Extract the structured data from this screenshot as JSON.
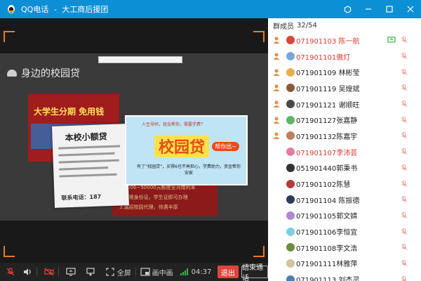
{
  "window": {
    "app_name": "QQ电话",
    "separator": "-",
    "group_name": "大工商后援团",
    "buttons": {
      "settings_icon": "hexagon-settings-icon",
      "minimize_icon": "minimize-icon",
      "maximize_icon": "maximize-icon",
      "close_icon": "close-icon"
    }
  },
  "video": {
    "slide_header": "身边的校园贷",
    "poster_title": "本校小额贷",
    "poster_footer": "联系电话：187",
    "red_banner_text": "大学生分期 免用钱",
    "red_board_lines": [
      "1.2000~50000元额度全河南利率",
      "2.只需身份证，学生证即可办理",
      "3.诚招校园代理，待遇丰厚"
    ],
    "ad_top": "人生导师，就会帮你，需要学费？",
    "ad_big": "校园贷",
    "ad_tag": "帮你出~",
    "ad_sub": "有了“校园贷”，买得6也不再担心，学费助力，资金帮你安家"
  },
  "controls": {
    "mic_muted_icon": "mic-muted-icon",
    "speaker_icon": "speaker-icon",
    "camera_off_icon": "camera-off-icon",
    "share_screen_icon": "share-screen-icon",
    "presenter_icon": "presenter-icon",
    "fullscreen_label": "全屏",
    "pip_label": "画中画",
    "timer": "04:37",
    "exit_label": "退出",
    "end_call_label": "结束通话"
  },
  "panel": {
    "title": "群成员",
    "count": "32/54",
    "members": [
      {
        "label": "071901103 陈一航",
        "host": true,
        "host_mark": true,
        "avatar": "#d9463b",
        "screenshare": true,
        "mic": "muted"
      },
      {
        "label": "071901101傲灯",
        "host": true,
        "host_mark": true,
        "avatar": "#7aa7d8",
        "screenshare": false,
        "mic": "muted"
      },
      {
        "label": "071901109 林彬莹",
        "host": false,
        "host_mark": true,
        "avatar": "#e8b04a",
        "screenshare": false,
        "mic": "muted"
      },
      {
        "label": "071901119 吴煌斌",
        "host": false,
        "host_mark": true,
        "avatar": "#8a5a3a",
        "screenshare": false,
        "mic": "muted"
      },
      {
        "label": "071901121 谢顺旺",
        "host": false,
        "host_mark": true,
        "avatar": "#4a4a4a",
        "screenshare": false,
        "mic": "muted"
      },
      {
        "label": "071901127张嘉静",
        "host": false,
        "host_mark": true,
        "avatar": "#63b36b",
        "screenshare": false,
        "mic": "muted"
      },
      {
        "label": "071901132陈嘉宇",
        "host": false,
        "host_mark": true,
        "avatar": "#c07f5f",
        "screenshare": false,
        "mic": "muted"
      },
      {
        "label": "071901107李沛芸",
        "host": true,
        "host_mark": false,
        "avatar": "#e27fa0",
        "screenshare": false,
        "mic": "muted"
      },
      {
        "label": "051901440郭秉书",
        "host": false,
        "host_mark": false,
        "avatar": "#333333",
        "screenshare": false,
        "mic": "muted"
      },
      {
        "label": "071901102陈慧",
        "host": false,
        "host_mark": false,
        "avatar": "#b53a3a",
        "screenshare": false,
        "mic": "muted"
      },
      {
        "label": "071901104 陈振德",
        "host": false,
        "host_mark": false,
        "avatar": "#2d3a5a",
        "screenshare": false,
        "mic": "muted"
      },
      {
        "label": "071901105郭文婧",
        "host": false,
        "host_mark": false,
        "avatar": "#b08ad0",
        "screenshare": false,
        "mic": "muted"
      },
      {
        "label": "071901106李恒宜",
        "host": false,
        "host_mark": false,
        "avatar": "#7ecfe0",
        "screenshare": false,
        "mic": "muted"
      },
      {
        "label": "071901108李文浩",
        "host": false,
        "host_mark": false,
        "avatar": "#6a8f3a",
        "screenshare": false,
        "mic": "muted"
      },
      {
        "label": "071901111林雅萍",
        "host": false,
        "host_mark": false,
        "avatar": "#d4c2a0",
        "screenshare": false,
        "mic": "muted"
      },
      {
        "label": "071901113 刘杰灵",
        "host": false,
        "host_mark": false,
        "avatar": "#4f7fb0",
        "screenshare": false,
        "mic": "muted"
      }
    ]
  }
}
